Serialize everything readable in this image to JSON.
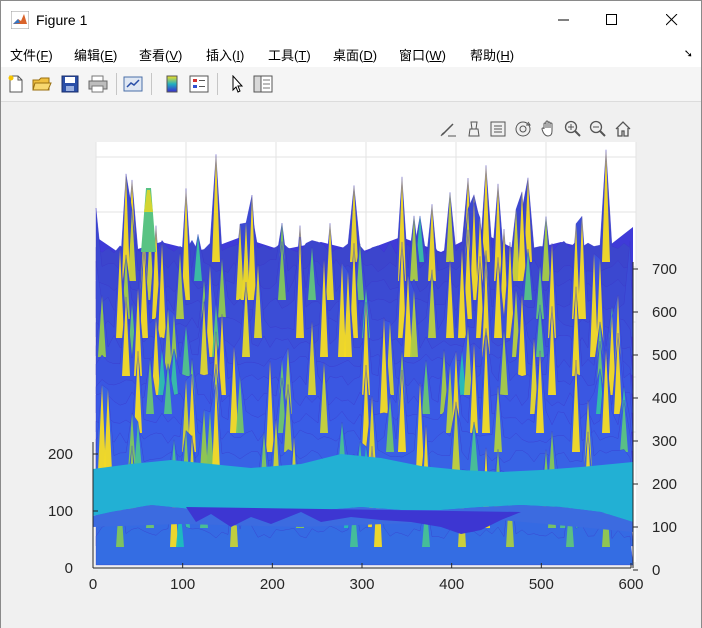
{
  "window": {
    "title": "Figure 1"
  },
  "menu": {
    "items": [
      {
        "label": "文件",
        "key": "F"
      },
      {
        "label": "编辑",
        "key": "E"
      },
      {
        "label": "查看",
        "key": "V"
      },
      {
        "label": "插入",
        "key": "I"
      },
      {
        "label": "工具",
        "key": "T"
      },
      {
        "label": "桌面",
        "key": "D"
      },
      {
        "label": "窗口",
        "key": "W"
      },
      {
        "label": "帮助",
        "key": "H"
      }
    ]
  },
  "toolbar": {
    "icons": [
      "new-figure-icon",
      "open-file-icon",
      "save-icon",
      "print-icon",
      "link-plot-icon",
      "colorbar-icon",
      "legend-icon",
      "edit-plot-arrow-icon",
      "property-inspector-icon"
    ]
  },
  "axes_toolbar": {
    "icons": [
      "brush-data-icon",
      "data-tips-icon",
      "rotate-3d-icon",
      "pan-icon",
      "zoom-in-icon",
      "zoom-out-icon",
      "home-icon"
    ]
  },
  "colors": {
    "surface_low": "#3b33d6",
    "surface_mid": "#2ea0d8",
    "surface_high": "#e8c832",
    "base_band": "#22b0d4"
  },
  "chart_data": {
    "type": "surface",
    "title": "",
    "x": {
      "ticks": [
        0,
        100,
        200,
        300,
        400,
        500,
        600
      ],
      "range": [
        0,
        600
      ]
    },
    "y_left": {
      "ticks": [
        0,
        100,
        200
      ],
      "range": [
        0,
        250
      ]
    },
    "z_right": {
      "ticks": [
        0,
        100,
        200,
        300,
        400,
        500,
        600,
        700
      ],
      "range": [
        0,
        700
      ]
    },
    "grid": true,
    "colormap": "parula"
  }
}
